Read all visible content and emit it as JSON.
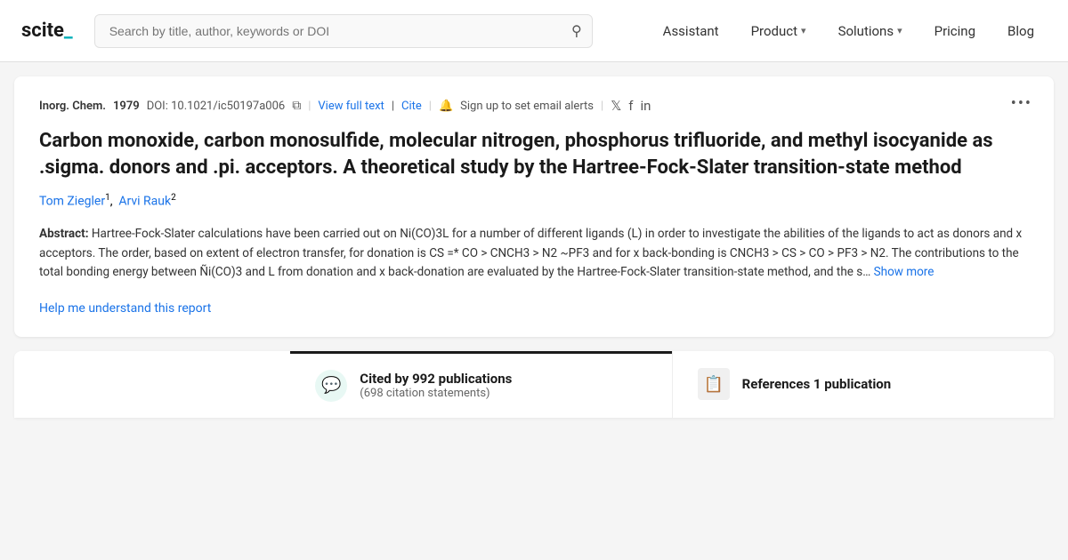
{
  "header": {
    "logo_text": "scite_",
    "search_placeholder": "Search by title, author, keywords or DOI",
    "nav": [
      {
        "label": "Assistant",
        "has_chevron": false
      },
      {
        "label": "Product",
        "has_chevron": true
      },
      {
        "label": "Solutions",
        "has_chevron": true
      },
      {
        "label": "Pricing",
        "has_chevron": false
      },
      {
        "label": "Blog",
        "has_chevron": false
      }
    ]
  },
  "paper": {
    "journal": "Inorg. Chem.",
    "year": "1979",
    "doi_label": "DOI: 10.1021/ic50197a006",
    "view_full_text": "View full text",
    "cite": "Cite",
    "sign_up_text": "Sign up to set email alerts",
    "more_icon": "•••",
    "title": "Carbon monoxide, carbon monosulfide, molecular nitrogen, phosphorus trifluoride, and methyl isocyanide as .sigma. donors and .pi. acceptors. A theoretical study by the Hartree-Fock-Slater transition-state method",
    "authors": [
      {
        "name": "Tom Ziegler",
        "sup": "1"
      },
      {
        "name": "Arvi Rauk",
        "sup": "2"
      }
    ],
    "abstract_label": "Abstract:",
    "abstract_text": "Hartree-Fock-Slater calculations have been carried out on Ni(CO)3L for a number of different ligands (L) in order to investigate the abilities of the ligands to act as donors and x acceptors. The order, based on extent of electron transfer, for donation is CS =* CO > CNCH3 > N2 ~PF3 and for x back-bonding is CNCH3 > CS > CO > PF3 > N2. The contributions to the total bonding energy between Ñi(CO)3 and L from donation and x back-donation are evaluated by the Hartree-Fock-Slater transition-state method, and the s…",
    "show_more": "Show more",
    "help_link": "Help me understand this report"
  },
  "stats": {
    "cited_main": "Cited by 992",
    "cited_sub_line1": "publications",
    "cited_paren": "(698 citation statements)",
    "refs_main": "References 1 publication"
  }
}
